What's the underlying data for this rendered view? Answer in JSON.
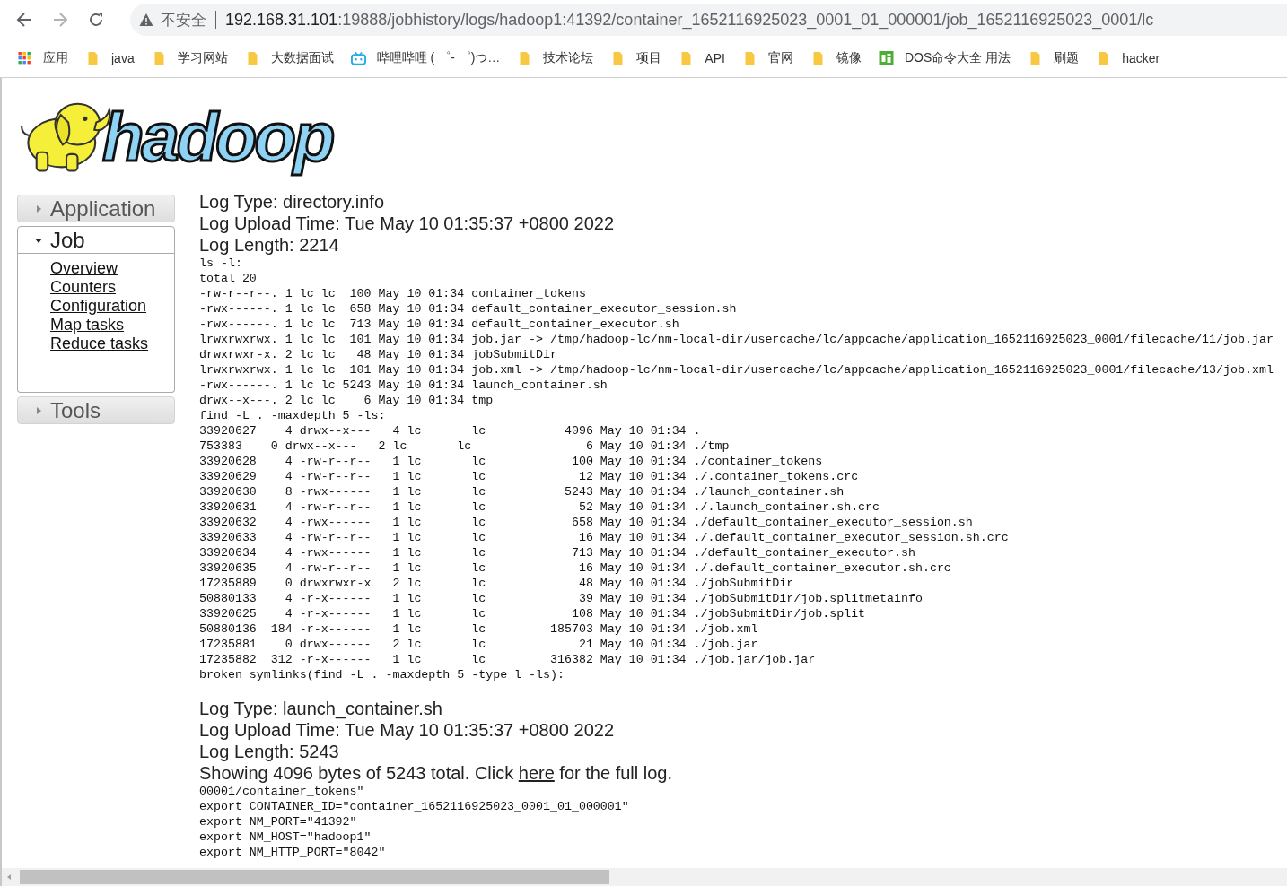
{
  "browser": {
    "security_label": "不安全",
    "url_host": "192.168.31.101",
    "url_path": ":19888/jobhistory/logs/hadoop1:41392/container_1652116925023_0001_01_000001/job_1652116925023_0001/lc",
    "bookmarks": [
      {
        "kind": "apps",
        "label": "应用"
      },
      {
        "kind": "folder",
        "label": "java"
      },
      {
        "kind": "folder",
        "label": "学习网站"
      },
      {
        "kind": "folder",
        "label": "大数据面试"
      },
      {
        "kind": "tv",
        "label": "哔哩哔哩 ( ゜- ゜)つ…"
      },
      {
        "kind": "folder",
        "label": "技术论坛"
      },
      {
        "kind": "folder",
        "label": "项目"
      },
      {
        "kind": "folder",
        "label": "API"
      },
      {
        "kind": "folder",
        "label": "官网"
      },
      {
        "kind": "folder",
        "label": "镜像"
      },
      {
        "kind": "site",
        "label": "DOS命令大全 用法"
      },
      {
        "kind": "folder",
        "label": "刷题"
      },
      {
        "kind": "folder",
        "label": "hacker"
      }
    ]
  },
  "logo": {
    "text": "hadoop"
  },
  "sidebar": [
    {
      "label": "Application",
      "expanded": false
    },
    {
      "label": "Job",
      "expanded": true,
      "links": [
        "Overview",
        "Counters",
        "Configuration",
        "Map tasks",
        "Reduce tasks"
      ]
    },
    {
      "label": "Tools",
      "expanded": false
    }
  ],
  "logs": [
    {
      "type": "Log Type: directory.info",
      "upload_time": "Log Upload Time: Tue May 10 01:35:37 +0800 2022",
      "length": "Log Length: 2214",
      "lines": [
        "ls -l:",
        "total 20",
        "-rw-r--r--. 1 lc lc  100 May 10 01:34 container_tokens",
        "-rwx------. 1 lc lc  658 May 10 01:34 default_container_executor_session.sh",
        "-rwx------. 1 lc lc  713 May 10 01:34 default_container_executor.sh",
        "lrwxrwxrwx. 1 lc lc  101 May 10 01:34 job.jar -> /tmp/hadoop-lc/nm-local-dir/usercache/lc/appcache/application_1652116925023_0001/filecache/11/job.jar",
        "drwxrwxr-x. 2 lc lc   48 May 10 01:34 jobSubmitDir",
        "lrwxrwxrwx. 1 lc lc  101 May 10 01:34 job.xml -> /tmp/hadoop-lc/nm-local-dir/usercache/lc/appcache/application_1652116925023_0001/filecache/13/job.xml",
        "-rwx------. 1 lc lc 5243 May 10 01:34 launch_container.sh",
        "drwx--x---. 2 lc lc    6 May 10 01:34 tmp",
        "find -L . -maxdepth 5 -ls:",
        "33920627    4 drwx--x---   4 lc       lc           4096 May 10 01:34 .",
        "753383    0 drwx--x---   2 lc       lc                6 May 10 01:34 ./tmp",
        "33920628    4 -rw-r--r--   1 lc       lc            100 May 10 01:34 ./container_tokens",
        "33920629    4 -rw-r--r--   1 lc       lc             12 May 10 01:34 ./.container_tokens.crc",
        "33920630    8 -rwx------   1 lc       lc           5243 May 10 01:34 ./launch_container.sh",
        "33920631    4 -rw-r--r--   1 lc       lc             52 May 10 01:34 ./.launch_container.sh.crc",
        "33920632    4 -rwx------   1 lc       lc            658 May 10 01:34 ./default_container_executor_session.sh",
        "33920633    4 -rw-r--r--   1 lc       lc             16 May 10 01:34 ./.default_container_executor_session.sh.crc",
        "33920634    4 -rwx------   1 lc       lc            713 May 10 01:34 ./default_container_executor.sh",
        "33920635    4 -rw-r--r--   1 lc       lc             16 May 10 01:34 ./.default_container_executor.sh.crc",
        "17235889    0 drwxrwxr-x   2 lc       lc             48 May 10 01:34 ./jobSubmitDir",
        "50880133    4 -r-x------   1 lc       lc             39 May 10 01:34 ./jobSubmitDir/job.splitmetainfo",
        "33920625    4 -r-x------   1 lc       lc            108 May 10 01:34 ./jobSubmitDir/job.split",
        "50880136  184 -r-x------   1 lc       lc         185703 May 10 01:34 ./job.xml",
        "17235881    0 drwx------   2 lc       lc             21 May 10 01:34 ./job.jar",
        "17235882  312 -r-x------   1 lc       lc         316382 May 10 01:34 ./job.jar/job.jar",
        "broken symlinks(find -L . -maxdepth 5 -type l -ls):"
      ]
    },
    {
      "type": "Log Type: launch_container.sh",
      "upload_time": "Log Upload Time: Tue May 10 01:35:37 +0800 2022",
      "length": "Log Length: 5243",
      "notice": {
        "before": "Showing 4096 bytes of 5243 total. Click ",
        "link": "here",
        "after": " for the full log."
      },
      "lines": [
        "00001/container_tokens\"",
        "export CONTAINER_ID=\"container_1652116925023_0001_01_000001\"",
        "export NM_PORT=\"41392\"",
        "export NM_HOST=\"hadoop1\"",
        "export NM_HTTP_PORT=\"8042\""
      ]
    }
  ]
}
